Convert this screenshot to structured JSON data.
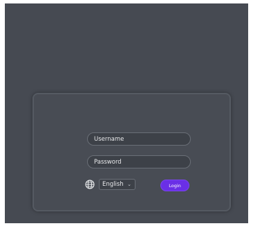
{
  "login": {
    "username_placeholder": "Username",
    "password_placeholder": "Password",
    "language": {
      "icon": "globe-icon",
      "selected": "English"
    },
    "login_label": "Login"
  },
  "colors": {
    "background": "#464a52",
    "panel": "#484c54",
    "accent": "#6a2fe6"
  }
}
